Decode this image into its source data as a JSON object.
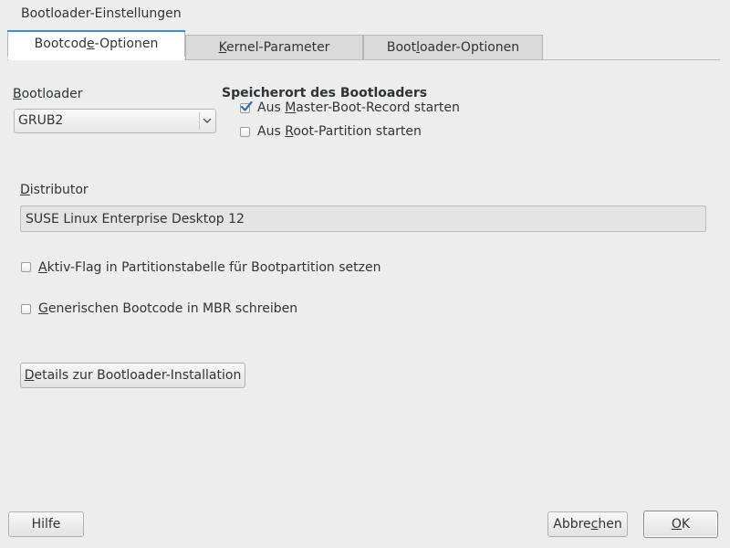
{
  "window": {
    "title": "Bootloader-Einstellungen"
  },
  "tabs": [
    {
      "label_pre": "Bootcod",
      "label_mn": "e",
      "label_post": "-Optionen",
      "active": true
    },
    {
      "label_pre": "",
      "label_mn": "K",
      "label_post": "ernel-Parameter",
      "active": false
    },
    {
      "label_pre": "Boot",
      "label_mn": "l",
      "label_post": "oader-Optionen",
      "active": false
    }
  ],
  "bootloader": {
    "label_pre": "",
    "label_mn": "B",
    "label_post": "ootloader",
    "value": "GRUB2"
  },
  "location": {
    "heading": "Speicherort des Bootloaders",
    "mbr": {
      "label_pre": "Aus ",
      "label_mn": "M",
      "label_post": "aster-Boot-Record starten",
      "checked": true
    },
    "root": {
      "label_pre": "Aus ",
      "label_mn": "R",
      "label_post": "oot-Partition starten",
      "checked": false
    }
  },
  "distributor": {
    "label_pre": "",
    "label_mn": "D",
    "label_post": "istributor",
    "value": "SUSE Linux Enterprise Desktop 12"
  },
  "options": {
    "active_flag": {
      "label_pre": "",
      "label_mn": "A",
      "label_post": "ktiv-Flag in Partitionstabelle für Bootpartition setzen",
      "checked": false
    },
    "generic_code": {
      "label_pre": "",
      "label_mn": "G",
      "label_post": "enerischen Bootcode in MBR schreiben",
      "checked": false
    }
  },
  "details_button": {
    "label_pre": "",
    "label_mn": "D",
    "label_post": "etails zur Bootloader-Installation"
  },
  "footer": {
    "help": "Hilfe",
    "cancel_pre": "Abbre",
    "cancel_mn": "c",
    "cancel_post": "hen",
    "ok_pre": "",
    "ok_mn": "O",
    "ok_post": "K"
  }
}
